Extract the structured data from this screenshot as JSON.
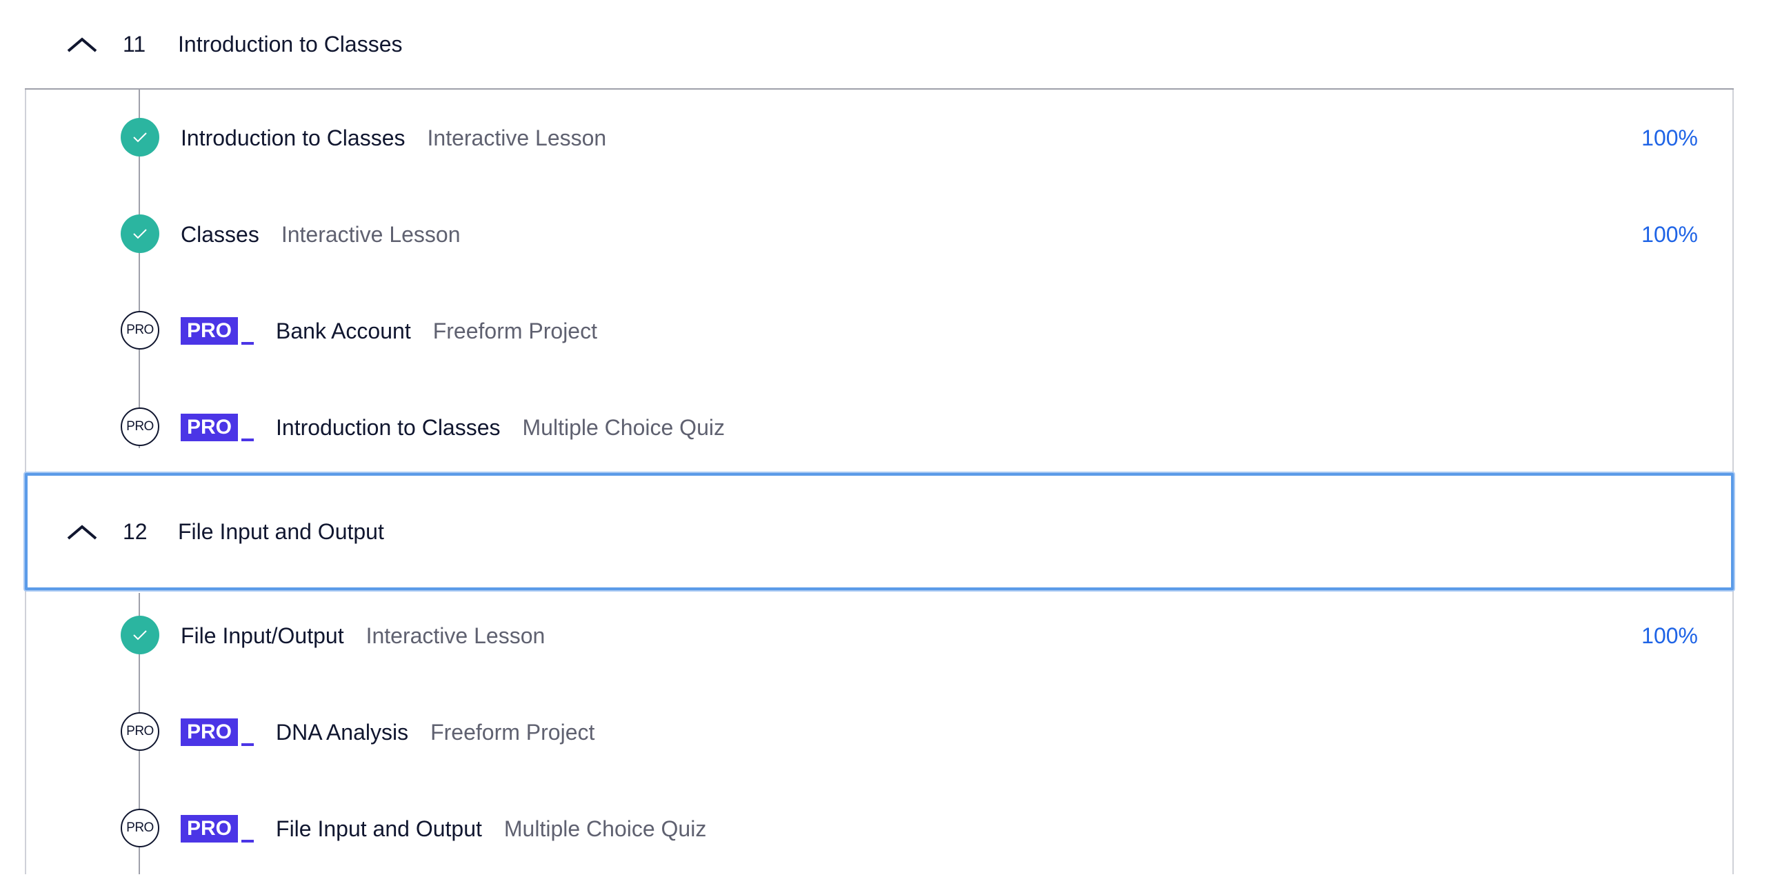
{
  "modules": [
    {
      "number": "11",
      "title": "Introduction to Classes",
      "items": [
        {
          "status": "complete",
          "pro": false,
          "title": "Introduction to Classes",
          "type": "Interactive Lesson",
          "progress": "100%"
        },
        {
          "status": "complete",
          "pro": false,
          "title": "Classes",
          "type": "Interactive Lesson",
          "progress": "100%"
        },
        {
          "status": "locked",
          "status_label": "PRO",
          "pro": true,
          "pro_label": "PRO",
          "title": "Bank Account",
          "type": "Freeform Project",
          "progress": ""
        },
        {
          "status": "locked",
          "status_label": "PRO",
          "pro": true,
          "pro_label": "PRO",
          "title": "Introduction to Classes",
          "type": "Multiple Choice Quiz",
          "progress": ""
        }
      ]
    },
    {
      "number": "12",
      "title": "File Input and Output",
      "items": [
        {
          "status": "complete",
          "pro": false,
          "title": "File Input/Output",
          "type": "Interactive Lesson",
          "progress": "100%"
        },
        {
          "status": "locked",
          "status_label": "PRO",
          "pro": true,
          "pro_label": "PRO",
          "title": "DNA Analysis",
          "type": "Freeform Project",
          "progress": ""
        },
        {
          "status": "locked",
          "status_label": "PRO",
          "pro": true,
          "pro_label": "PRO",
          "title": "File Input and Output",
          "type": "Multiple Choice Quiz",
          "progress": ""
        }
      ]
    }
  ],
  "icons": {
    "collapse": "chevron-up-icon",
    "complete": "checkmark-icon"
  },
  "colors": {
    "complete": "#2bb5a0",
    "pro_badge": "#4b35e6",
    "progress_text": "#1f64e6",
    "focus_ring": "#5b9be8"
  }
}
